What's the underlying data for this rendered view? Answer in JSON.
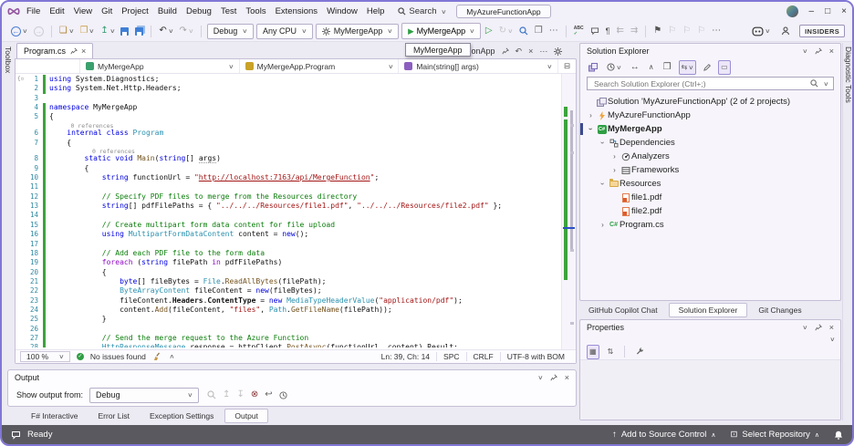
{
  "titlebar": {
    "search_label": "Search",
    "solution_box": "MyAzureFunctionApp",
    "insiders_label": "INSIDERS"
  },
  "menubar": {
    "items": [
      "File",
      "Edit",
      "View",
      "Git",
      "Project",
      "Build",
      "Debug",
      "Test",
      "Tools",
      "Extensions",
      "Window",
      "Help"
    ]
  },
  "toolbar": {
    "buttons": [
      {
        "icon": "nav-back-icon",
        "chev": true
      },
      {
        "icon": "nav-forward-icon",
        "disabled": true
      },
      {
        "sep": true
      },
      {
        "icon": "new-project-icon",
        "chev": true
      },
      {
        "icon": "open-file-icon",
        "chev": true
      },
      {
        "icon": "publish-icon",
        "chev": true
      },
      {
        "icon": "save-icon"
      },
      {
        "icon": "save-all-icon"
      },
      {
        "sep": true
      },
      {
        "icon": "undo-icon",
        "chev": true
      },
      {
        "icon": "redo-icon",
        "chev": true,
        "disabled": true
      },
      {
        "sep": true
      }
    ],
    "config_dropdown": "Debug",
    "platform_dropdown": "Any CPU",
    "startup_dropdown": "MyMergeApp",
    "run_button": "MyMergeApp",
    "after_run": [
      {
        "icon": "start-without-debugging-icon"
      },
      {
        "icon": "hot-reload-icon",
        "chev": true,
        "disabled": true
      },
      {
        "icon": "find-in-files-icon"
      },
      {
        "icon": "window-layout-icon"
      },
      {
        "icon": "more-icon"
      }
    ],
    "text_group": [
      {
        "icon": "spell-check-icon"
      },
      {
        "icon": "comment-icon"
      },
      {
        "icon": "whitespace-icon"
      },
      {
        "icon": "indent-decrease-icon",
        "disabled": true
      },
      {
        "icon": "indent-increase-icon",
        "disabled": true
      },
      {
        "sep": true
      },
      {
        "icon": "bookmark-icon"
      },
      {
        "icon": "bookmark-prev-icon",
        "disabled": true
      },
      {
        "icon": "bookmark-next-icon",
        "disabled": true
      },
      {
        "icon": "bookmark-clear-icon",
        "disabled": true
      },
      {
        "icon": "more-icon"
      }
    ]
  },
  "left_strip": {
    "label": "Toolbox"
  },
  "right_strip": {
    "label": "Diagnostic Tools"
  },
  "editor": {
    "tab": "Program.cs",
    "tab2_fragment": "reFunctionApp",
    "tab_tooltip": "MyMergeApp",
    "breadcrumbs": [
      "MyMergeApp",
      "MyMergeApp.Program",
      "Main(string[] args)"
    ],
    "code": {
      "rows": [
        {
          "n": 1,
          "chg": true,
          "seg": [
            [
              "k",
              "using"
            ],
            [
              "p",
              " System.Diagnostics;"
            ]
          ]
        },
        {
          "n": 2,
          "chg": true,
          "seg": [
            [
              "k",
              "using"
            ],
            [
              "p",
              " System.Net.Http.Headers;"
            ]
          ]
        },
        {
          "n": 3,
          "chg": false,
          "seg": []
        },
        {
          "n": 4,
          "chg": true,
          "seg": [
            [
              "k",
              "namespace"
            ],
            [
              "p",
              " MyMergeApp"
            ]
          ]
        },
        {
          "n": 5,
          "chg": true,
          "seg": [
            [
              "p",
              "{"
            ]
          ]
        },
        {
          "lens": true,
          "chg": true,
          "seg": [
            [
              "lens",
              "      0 references"
            ]
          ]
        },
        {
          "n": 6,
          "chg": true,
          "seg": [
            [
              "p",
              "    "
            ],
            [
              "k",
              "internal"
            ],
            [
              "p",
              " "
            ],
            [
              "k",
              "class"
            ],
            [
              "p",
              " "
            ],
            [
              "t",
              "Program"
            ]
          ]
        },
        {
          "n": 7,
          "chg": true,
          "seg": [
            [
              "p",
              "    {"
            ]
          ]
        },
        {
          "lens": true,
          "chg": true,
          "seg": [
            [
              "lens",
              "            0 references"
            ]
          ]
        },
        {
          "n": 8,
          "chg": true,
          "seg": [
            [
              "p",
              "        "
            ],
            [
              "k",
              "static"
            ],
            [
              "p",
              " "
            ],
            [
              "k",
              "void"
            ],
            [
              "p",
              " "
            ],
            [
              "m",
              "Main"
            ],
            [
              "p",
              "("
            ],
            [
              "k",
              "string"
            ],
            [
              "p",
              "[] "
            ],
            [
              "pr",
              "args"
            ],
            [
              "p",
              ")"
            ]
          ]
        },
        {
          "n": 9,
          "chg": true,
          "seg": [
            [
              "p",
              "        {"
            ]
          ]
        },
        {
          "n": 10,
          "chg": true,
          "seg": [
            [
              "p",
              "            "
            ],
            [
              "k",
              "string"
            ],
            [
              "p",
              " functionUrl = "
            ],
            [
              "s",
              "\""
            ],
            [
              "u",
              "http://localhost:7163/api/MergeFunction"
            ],
            [
              "s",
              "\""
            ],
            [
              "p",
              ";"
            ]
          ]
        },
        {
          "n": 11,
          "chg": true,
          "seg": []
        },
        {
          "n": 12,
          "chg": true,
          "seg": [
            [
              "p",
              "            "
            ],
            [
              "cm",
              "// Specify PDF files to merge from the Resources directory"
            ]
          ]
        },
        {
          "n": 13,
          "chg": true,
          "seg": [
            [
              "p",
              "            "
            ],
            [
              "k",
              "string"
            ],
            [
              "p",
              "[] pdfFilePaths = { "
            ],
            [
              "s",
              "\"../../../Resources/file1.pdf\""
            ],
            [
              "p",
              ", "
            ],
            [
              "s",
              "\"../../../Resources/file2.pdf\""
            ],
            [
              "p",
              " };"
            ]
          ]
        },
        {
          "n": 14,
          "chg": true,
          "seg": []
        },
        {
          "n": 15,
          "chg": true,
          "seg": [
            [
              "p",
              "            "
            ],
            [
              "cm",
              "// Create multipart form data content for file upload"
            ]
          ]
        },
        {
          "n": 16,
          "chg": true,
          "seg": [
            [
              "p",
              "            "
            ],
            [
              "k",
              "using"
            ],
            [
              "p",
              " "
            ],
            [
              "t",
              "MultipartFormDataContent"
            ],
            [
              "p",
              " content = "
            ],
            [
              "k",
              "new"
            ],
            [
              "p",
              "();"
            ]
          ]
        },
        {
          "n": 17,
          "chg": true,
          "seg": []
        },
        {
          "n": 18,
          "chg": true,
          "seg": [
            [
              "p",
              "            "
            ],
            [
              "cm",
              "// Add each PDF file to the form data"
            ]
          ]
        },
        {
          "n": 19,
          "chg": true,
          "seg": [
            [
              "p",
              "            "
            ],
            [
              "c",
              "foreach"
            ],
            [
              "p",
              " ("
            ],
            [
              "k",
              "string"
            ],
            [
              "p",
              " filePath "
            ],
            [
              "c",
              "in"
            ],
            [
              "p",
              " pdfFilePaths)"
            ]
          ]
        },
        {
          "n": 20,
          "chg": true,
          "seg": [
            [
              "p",
              "            {"
            ]
          ]
        },
        {
          "n": 21,
          "chg": true,
          "seg": [
            [
              "p",
              "                "
            ],
            [
              "k",
              "byte"
            ],
            [
              "p",
              "[] fileBytes = "
            ],
            [
              "t",
              "File"
            ],
            [
              "p",
              "."
            ],
            [
              "m",
              "ReadAllBytes"
            ],
            [
              "p",
              "(filePath);"
            ]
          ]
        },
        {
          "n": 22,
          "chg": true,
          "seg": [
            [
              "p",
              "                "
            ],
            [
              "t",
              "ByteArrayContent"
            ],
            [
              "p",
              " fileContent = "
            ],
            [
              "k",
              "new"
            ],
            [
              "p",
              "(fileBytes);"
            ]
          ]
        },
        {
          "n": 23,
          "chg": true,
          "seg": [
            [
              "p",
              "                fileContent."
            ],
            [
              "b",
              "Headers"
            ],
            [
              "p",
              "."
            ],
            [
              "b",
              "ContentType"
            ],
            [
              "p",
              " = "
            ],
            [
              "k",
              "new"
            ],
            [
              "p",
              " "
            ],
            [
              "t",
              "MediaTypeHeaderValue"
            ],
            [
              "p",
              "("
            ],
            [
              "s",
              "\"application/pdf\""
            ],
            [
              "p",
              ");"
            ]
          ]
        },
        {
          "n": 24,
          "chg": true,
          "seg": [
            [
              "p",
              "                content."
            ],
            [
              "m",
              "Add"
            ],
            [
              "p",
              "(fileContent, "
            ],
            [
              "s",
              "\"files\""
            ],
            [
              "p",
              ", "
            ],
            [
              "t",
              "Path"
            ],
            [
              "p",
              "."
            ],
            [
              "m",
              "GetFileName"
            ],
            [
              "p",
              "(filePath));"
            ]
          ]
        },
        {
          "n": 25,
          "chg": true,
          "seg": [
            [
              "p",
              "            }"
            ]
          ]
        },
        {
          "n": 26,
          "chg": true,
          "seg": []
        },
        {
          "n": 27,
          "chg": true,
          "seg": [
            [
              "p",
              "            "
            ],
            [
              "cm",
              "// Send the merge request to the Azure Function"
            ]
          ]
        },
        {
          "n": 28,
          "chg": true,
          "clip": true,
          "seg": [
            [
              "p",
              "            "
            ],
            [
              "t",
              "HttpResponseMessage"
            ],
            [
              "p",
              " response = httpClient."
            ],
            [
              "m",
              "PostAsync"
            ],
            [
              "p",
              "(functionUrl, content).Result;"
            ]
          ]
        }
      ]
    },
    "status": {
      "zoom": "100 %",
      "issues": "No issues found",
      "position": "Ln: 39, Ch: 14",
      "spaces": "SPC",
      "line_endings": "CRLF",
      "encoding": "UTF-8 with BOM"
    }
  },
  "solution_explorer": {
    "title": "Solution Explorer",
    "search_placeholder": "Search Solution Explorer (Ctrl+;)",
    "toolbar_icons": [
      {
        "icon": "se-home-icon"
      },
      {
        "icon": "se-timeline-icon",
        "chev": true
      },
      {
        "icon": "se-switch-icon"
      },
      {
        "icon": "se-collapse-all-icon"
      },
      {
        "icon": "se-copy-icon"
      },
      {
        "icon": "se-sync-icon",
        "chev": true,
        "boxed": true
      },
      {
        "icon": "se-edit-icon"
      },
      {
        "icon": "se-preview-icon",
        "boxed": true
      }
    ],
    "tree": [
      {
        "label": "Solution 'MyAzureFunctionApp' (2 of 2 projects)",
        "icon": "solution",
        "indent": 0,
        "chev": ""
      },
      {
        "label": "MyAzureFunctionApp",
        "icon": "azure-function",
        "indent": 0,
        "chev": "col"
      },
      {
        "label": "MyMergeApp",
        "icon": "csharp-project",
        "indent": 0,
        "chev": "exp",
        "selected": true
      },
      {
        "label": "Dependencies",
        "icon": "dependencies",
        "indent": 1,
        "chev": "exp"
      },
      {
        "label": "Analyzers",
        "icon": "analyzers",
        "indent": 2,
        "chev": "col"
      },
      {
        "label": "Frameworks",
        "icon": "frameworks",
        "indent": 2,
        "chev": "col"
      },
      {
        "label": "Resources",
        "icon": "folder",
        "indent": 1,
        "chev": "exp"
      },
      {
        "label": "file1.pdf",
        "icon": "pdf-file",
        "indent": 2,
        "chev": ""
      },
      {
        "label": "file2.pdf",
        "icon": "pdf-file",
        "indent": 2,
        "chev": ""
      },
      {
        "label": "Program.cs",
        "icon": "csharp-file",
        "indent": 1,
        "chev": "col"
      }
    ],
    "tabs": [
      "GitHub Copilot Chat",
      "Solution Explorer",
      "Git Changes"
    ],
    "active_tab": "Solution Explorer"
  },
  "properties": {
    "title": "Properties",
    "toolbar_icons": [
      {
        "icon": "prop-categorized-icon",
        "boxed": true
      },
      {
        "icon": "prop-alphabetical-icon"
      },
      {
        "sep": true
      },
      {
        "icon": "prop-pages-icon"
      }
    ]
  },
  "output": {
    "title": "Output",
    "show_from_label": "Show output from:",
    "source": "Debug",
    "toolbar_icons": [
      {
        "icon": "output-find-icon",
        "disabled": true
      },
      {
        "icon": "output-prev-icon",
        "disabled": true
      },
      {
        "icon": "output-next-icon",
        "disabled": true
      },
      {
        "icon": "output-clear-icon"
      },
      {
        "icon": "output-wrap-icon"
      },
      {
        "icon": "output-time-icon"
      }
    ]
  },
  "bottom_tabs": {
    "tabs": [
      "F# Interactive",
      "Error List",
      "Exception Settings",
      "Output"
    ],
    "active_tab": "Output"
  },
  "statusbar": {
    "ready": "Ready",
    "add_source_control": "Add to Source Control",
    "select_repository": "Select Repository"
  }
}
